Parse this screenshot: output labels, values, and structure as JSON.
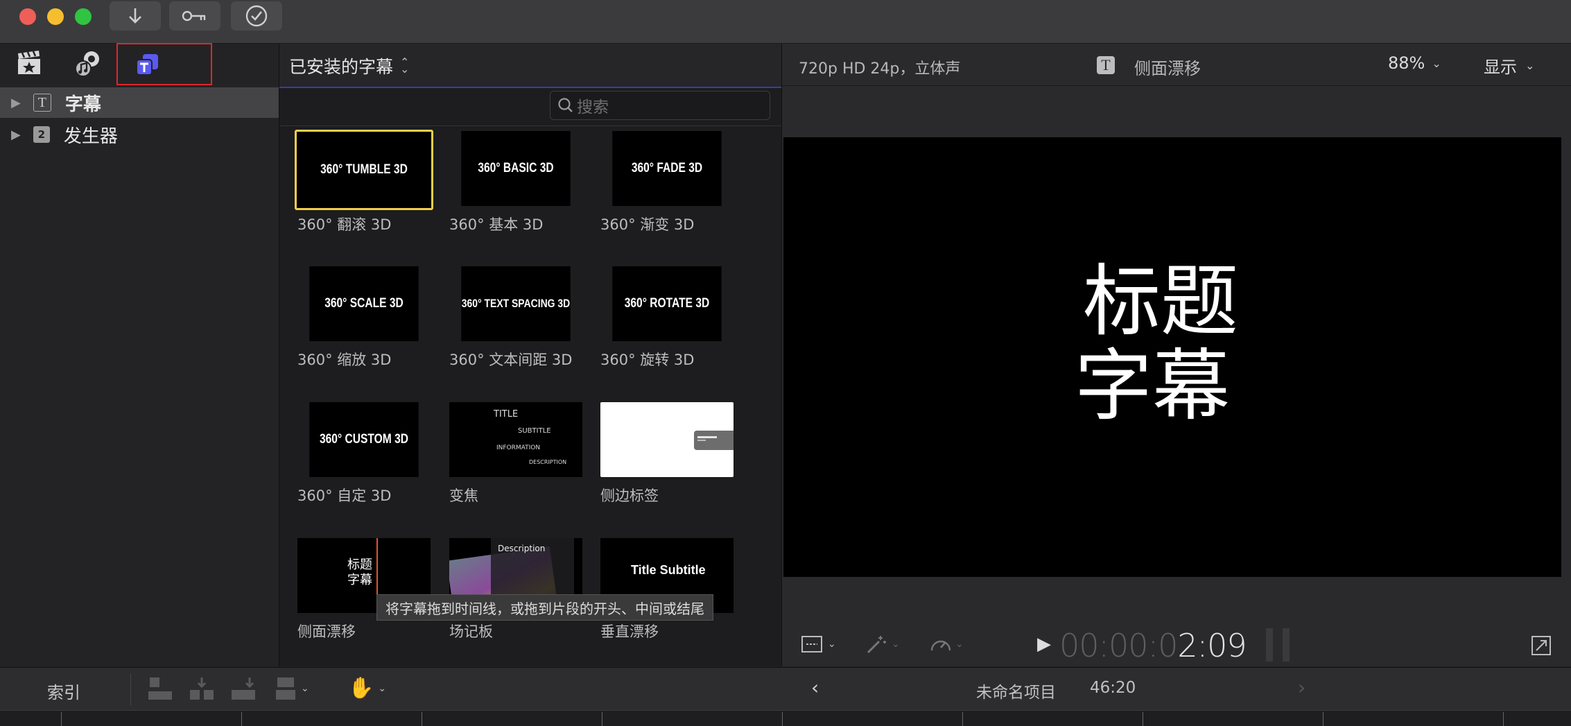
{
  "toolbar": {
    "import_icon": "download-arrow-icon",
    "keyword_icon": "key-icon",
    "check_icon": "checkmark-circle-icon"
  },
  "sidebar": {
    "tabs": [
      "photos-audio",
      "clapper",
      "titles-generators"
    ],
    "items": [
      {
        "label": "字幕",
        "selected": true
      },
      {
        "label": "发生器",
        "selected": false
      }
    ]
  },
  "browser": {
    "title": "已安装的字幕",
    "search_placeholder": "搜索",
    "tiles": [
      {
        "thumb": "360° TUMBLE 3D",
        "label": "360° 翻滚 3D",
        "selected": true
      },
      {
        "thumb": "360° BASIC 3D",
        "label": "360° 基本 3D"
      },
      {
        "thumb": "360° FADE 3D",
        "label": "360° 渐变 3D"
      },
      {
        "thumb": "360° SCALE 3D",
        "label": "360° 缩放 3D"
      },
      {
        "thumb": "360° TEXT SPACING 3D",
        "label": "360° 文本间距 3D"
      },
      {
        "thumb": "360° ROTATE 3D",
        "label": "360° 旋转 3D"
      },
      {
        "thumb": "360° CUSTOM 3D",
        "label": "360° 自定 3D"
      },
      {
        "thumb": "",
        "label": "变焦",
        "lines": [
          "TITLE",
          "SUBTITLE",
          "INFORMATION",
          "DESCRIPTION"
        ]
      },
      {
        "thumb": "",
        "label": "侧边标签"
      },
      {
        "thumb": "标题 字幕",
        "label": "侧面漂移"
      },
      {
        "thumb": "Description",
        "label": "场记板"
      },
      {
        "thumb": "Title Subtitle",
        "label": "垂直漂移"
      }
    ],
    "tooltip": "将字幕拖到时间线，或拖到片段的开头、中间或结尾"
  },
  "viewer": {
    "format": "720p HD 24p，立体声",
    "clip_name": "侧面漂移",
    "zoom": "88%",
    "display": "显示",
    "preview_line1": "标题",
    "preview_line2": "字幕",
    "timecode_dim": "00:00:0",
    "timecode_bright": "2:09"
  },
  "bottom": {
    "index": "索引",
    "project": "未命名项目",
    "duration": "46:20"
  },
  "colors": {
    "accent": "#5a5af0",
    "selection": "#f2cf4a",
    "tooltip_bg": "#3a3a3a"
  }
}
